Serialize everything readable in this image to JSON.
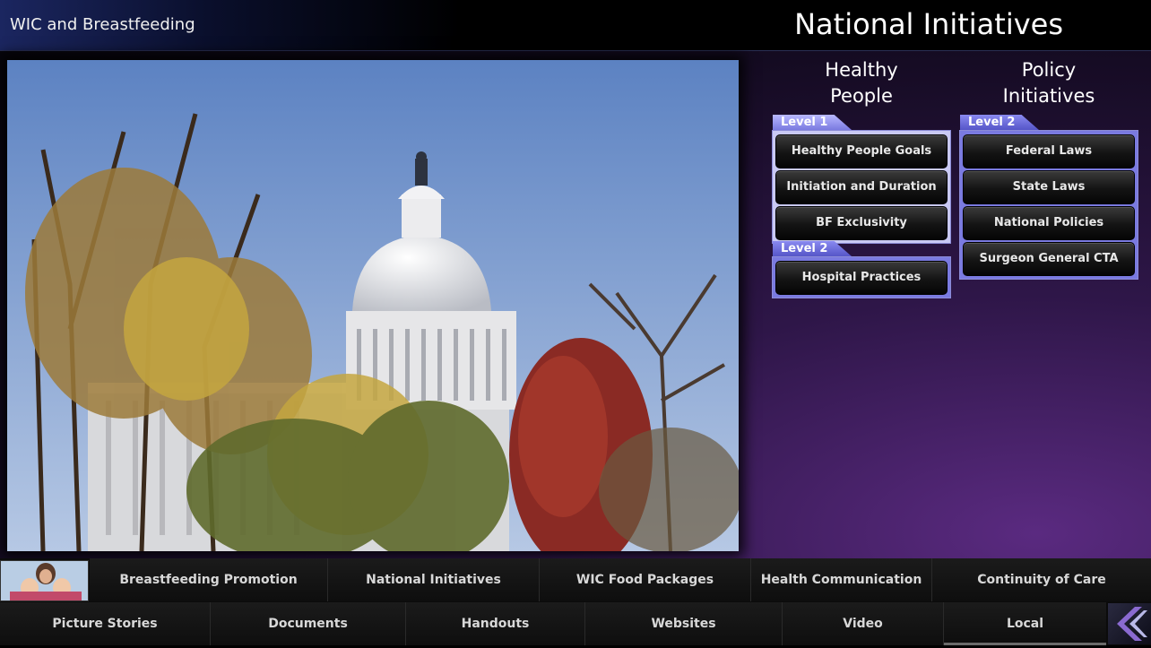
{
  "header": {
    "app_title": "WIC and Breastfeeding",
    "page_title": "National Initiatives"
  },
  "columns": [
    {
      "title_line1": "Healthy",
      "title_line2": "People",
      "groups": [
        {
          "level": "Level 1",
          "items": [
            "Healthy People Goals",
            "Initiation and Duration",
            "BF Exclusivity"
          ]
        },
        {
          "level": "Level 2",
          "items": [
            "Hospital Practices"
          ]
        }
      ]
    },
    {
      "title_line1": "Policy",
      "title_line2": "Initiatives",
      "groups": [
        {
          "level": "Level 2",
          "items": [
            "Federal  Laws",
            "State  Laws",
            "National Policies",
            "Surgeon General CTA"
          ]
        }
      ]
    }
  ],
  "bottom_nav": {
    "row1": [
      "Breastfeeding Promotion",
      "National Initiatives",
      "WIC Food Packages",
      "Health Communication",
      "Continuity of Care"
    ],
    "row2": [
      "Picture Stories",
      "Documents",
      "Handouts",
      "Websites",
      "Video",
      "Local"
    ]
  },
  "colors": {
    "level_tab": "#6464d8",
    "panel_bg": "#c9c9f4",
    "button_dark": "#141414"
  },
  "icons": {
    "back": "chevron-left-icon"
  }
}
